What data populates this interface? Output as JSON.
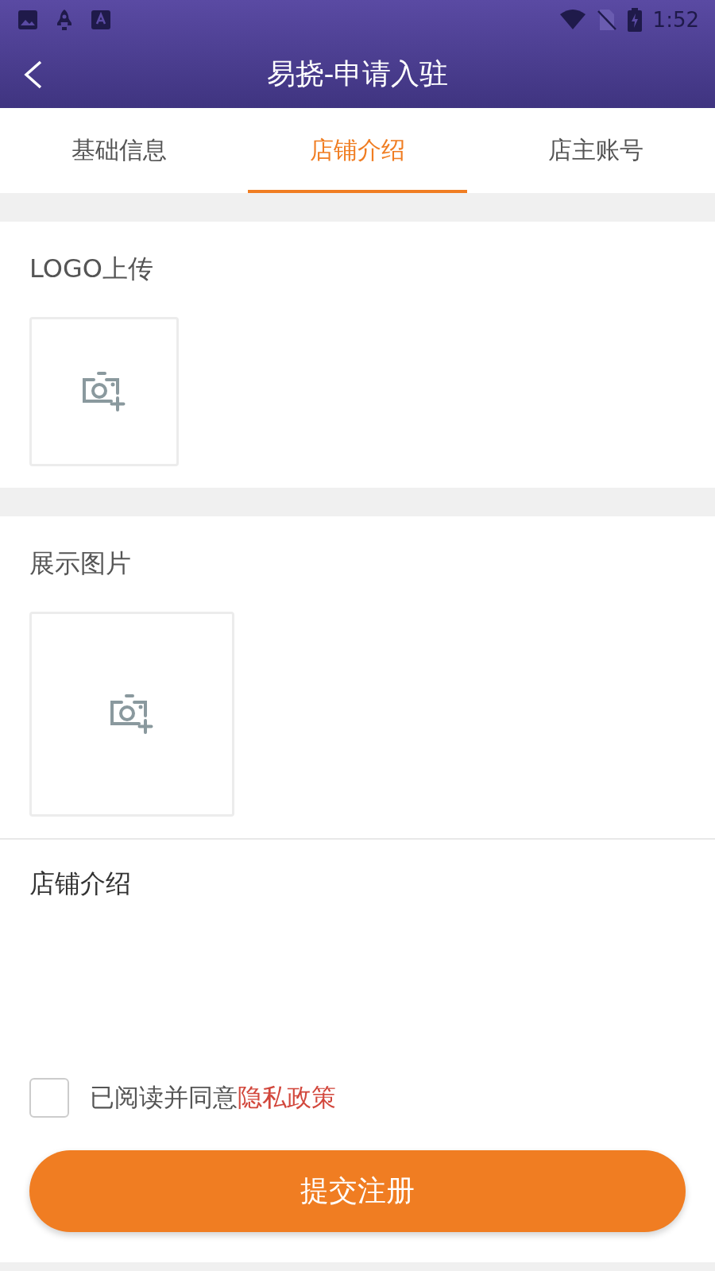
{
  "status_bar": {
    "time": "1:52"
  },
  "header": {
    "title": "易挠-申请入驻"
  },
  "tabs": [
    {
      "label": "基础信息",
      "selected": false
    },
    {
      "label": "店铺介绍",
      "selected": true
    },
    {
      "label": "店主账号",
      "selected": false
    }
  ],
  "sections": [
    {
      "kind": "upload",
      "label": "LOGO上传"
    },
    {
      "kind": "upload",
      "label": "展示图片"
    },
    {
      "kind": "textarea",
      "label": "店铺介绍"
    }
  ],
  "agreement": {
    "checked": false,
    "text": "已阅读并同意",
    "link": "隐私政策"
  },
  "submit_button": {
    "label": "提交注册"
  }
}
